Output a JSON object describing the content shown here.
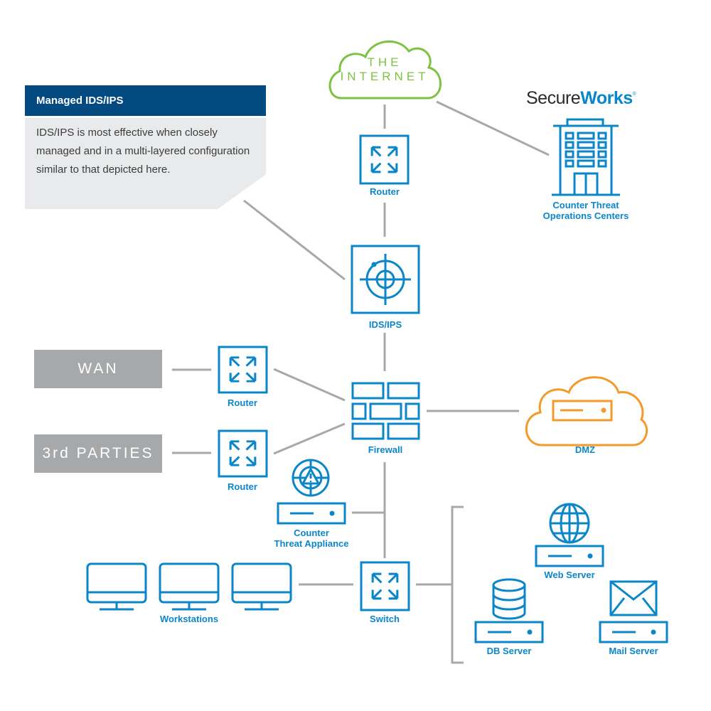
{
  "callout": {
    "title": "Managed IDS/IPS",
    "body": "IDS/IPS is most effective when closely managed and in a multi-layered configuration similar to that depicted here."
  },
  "brand": {
    "name_part1": "Secure",
    "name_part2": "Works",
    "registered_mark": "®"
  },
  "colors": {
    "icon_blue": "#0a86c9",
    "callout_header": "#024a80",
    "callout_body": "#e9eaeb",
    "connector_gray": "#a7a8aa",
    "internet_green": "#7dc242",
    "dmz_orange": "#f39a2b"
  },
  "nodes": {
    "internet": {
      "line1": "THE",
      "line2": "INTERNET",
      "icon": "cloud-icon"
    },
    "router_top": {
      "label": "Router",
      "icon": "router-arrows-icon"
    },
    "ctoc": {
      "line1": "Counter Threat",
      "line2": "Operations Centers",
      "icon": "building-icon"
    },
    "idsips": {
      "label": "IDS/IPS",
      "icon": "crosshair-target-icon"
    },
    "wan": {
      "label": "WAN"
    },
    "third_parties": {
      "label": "3rd PARTIES"
    },
    "router_wan": {
      "label": "Router",
      "icon": "router-arrows-icon"
    },
    "router_3rd": {
      "label": "Router",
      "icon": "router-arrows-icon"
    },
    "firewall": {
      "label": "Firewall",
      "icon": "brick-wall-icon"
    },
    "dmz": {
      "label": "DMZ",
      "icon": "cloud-server-icon"
    },
    "cta": {
      "line1": "Counter",
      "line2": "Threat Appliance",
      "icon": "radar-warning-icon"
    },
    "workstations": {
      "label": "Workstations",
      "icon": "monitor-icon"
    },
    "switch": {
      "label": "Switch",
      "icon": "switch-arrows-icon"
    },
    "web_server": {
      "label": "Web Server",
      "icon": "globe-icon"
    },
    "db_server": {
      "label": "DB Server",
      "icon": "database-icon"
    },
    "mail_server": {
      "label": "Mail Server",
      "icon": "envelope-icon"
    }
  }
}
